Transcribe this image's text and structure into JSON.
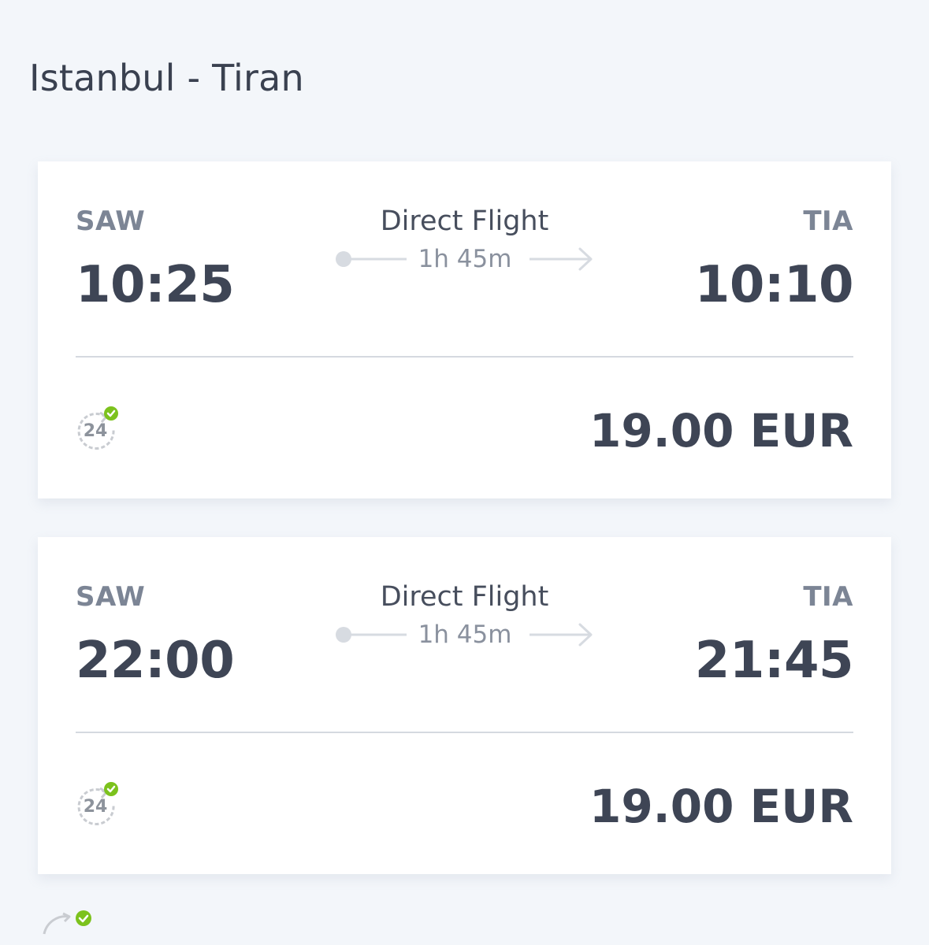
{
  "header": {
    "title": "Istanbul - Tiran"
  },
  "flights": [
    {
      "origin_code": "SAW",
      "destination_code": "TIA",
      "departure_time": "10:25",
      "arrival_time": "10:10",
      "flight_type": "Direct Flight",
      "duration": "1h 45m",
      "guarantee_icon": "24h-check-icon",
      "price": "19.00 EUR"
    },
    {
      "origin_code": "SAW",
      "destination_code": "TIA",
      "departure_time": "22:00",
      "arrival_time": "21:45",
      "flight_type": "Direct Flight",
      "duration": "1h 45m",
      "guarantee_icon": "24h-check-icon",
      "price": "19.00 EUR"
    }
  ],
  "colors": {
    "background": "#f3f6fa",
    "card": "#ffffff",
    "text_dark": "#3e4555",
    "text_muted": "#7c8595",
    "check_green": "#7cc21d",
    "divider": "#d5d9e0"
  }
}
